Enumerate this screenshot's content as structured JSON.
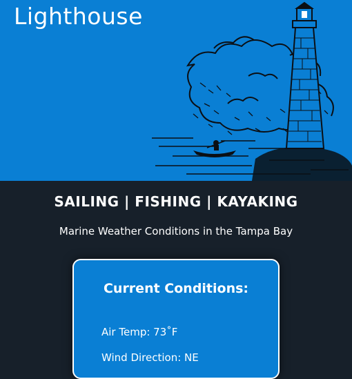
{
  "header": {
    "title": "Lighthouse",
    "illustration": "lighthouse-sketch"
  },
  "activities": {
    "text": "SAILING | FISHING | KAYAKING"
  },
  "subtitle": {
    "text": "Marine Weather Conditions in the Tampa Bay"
  },
  "conditions": {
    "title": "Current Conditions:",
    "air_temp": "Air Temp: 73˚F",
    "wind_direction": "Wind Direction: NE"
  },
  "colors": {
    "brand_blue": "#0a7fd4",
    "background": "#17202a",
    "text": "#ffffff"
  }
}
